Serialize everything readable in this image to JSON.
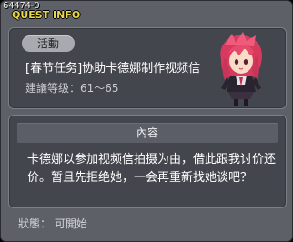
{
  "window": {
    "id_label": "64474-0",
    "title": "QUEST INFO"
  },
  "quest": {
    "badge": "活動",
    "name": "[春节任务]协助卡德娜制作视频信",
    "level": "建議等级：61～65",
    "npc_icon": "npc-portrait-pink-hair"
  },
  "content": {
    "header": "內容",
    "description": "卡德娜以参加视频信拍摄为由，借此跟我讨价还价。暂且先拒绝她，一会再重新找她谈吧？"
  },
  "status": "狀態： 可開始",
  "colors": {
    "title": "#e8d84a",
    "window_bg": "#5e6068",
    "panel_bg": "#44464e",
    "badge_bg": "#a8aab0",
    "npc_hair": "#e84a6c"
  }
}
